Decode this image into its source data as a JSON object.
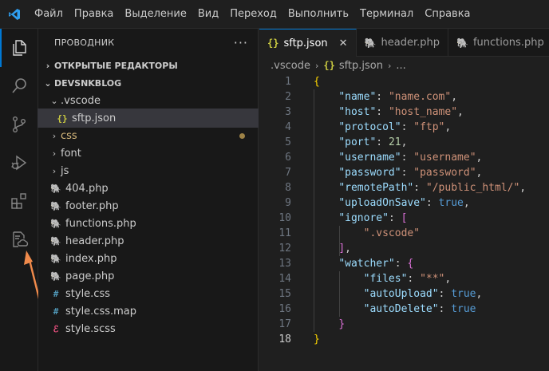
{
  "menu": [
    "Файл",
    "Правка",
    "Выделение",
    "Вид",
    "Переход",
    "Выполнить",
    "Терминал",
    "Справка"
  ],
  "sidebar": {
    "title": "ПРОВОДНИК",
    "more": "···",
    "open_editors": "ОТКРЫТЫЕ РЕДАКТОРЫ",
    "project": "DEVSNKBLOG",
    "tree": [
      {
        "label": ".vscode",
        "type": "folder-open"
      },
      {
        "label": "sftp.json",
        "type": "json"
      },
      {
        "label": "css",
        "type": "folder"
      },
      {
        "label": "font",
        "type": "folder"
      },
      {
        "label": "js",
        "type": "folder"
      },
      {
        "label": "404.php",
        "type": "php"
      },
      {
        "label": "footer.php",
        "type": "php"
      },
      {
        "label": "functions.php",
        "type": "php"
      },
      {
        "label": "header.php",
        "type": "php"
      },
      {
        "label": "index.php",
        "type": "php"
      },
      {
        "label": "page.php",
        "type": "php"
      },
      {
        "label": "style.css",
        "type": "css"
      },
      {
        "label": "style.css.map",
        "type": "css"
      },
      {
        "label": "style.scss",
        "type": "scss"
      }
    ]
  },
  "tabs": [
    {
      "label": "sftp.json",
      "active": true
    },
    {
      "label": "header.php",
      "active": false
    },
    {
      "label": "functions.php",
      "active": false
    }
  ],
  "breadcrumb": {
    "folder": ".vscode",
    "file": "sftp.json",
    "trail": "..."
  },
  "editor": {
    "line_numbers": [
      "1",
      "2",
      "3",
      "4",
      "5",
      "6",
      "7",
      "8",
      "9",
      "10",
      "11",
      "12",
      "13",
      "14",
      "15",
      "16",
      "17",
      "18"
    ],
    "current_line": "18",
    "k_name": "\"name\"",
    "v_name": "\"name.com\"",
    "k_host": "\"host\"",
    "v_host": "\"host_name\"",
    "k_protocol": "\"protocol\"",
    "v_protocol": "\"ftp\"",
    "k_port": "\"port\"",
    "v_port": "21",
    "k_username": "\"username\"",
    "v_username": "\"username\"",
    "k_password": "\"password\"",
    "v_password": "\"password\"",
    "k_remote": "\"remotePath\"",
    "v_remote": "\"/public_html/\"",
    "k_upload": "\"uploadOnSave\"",
    "v_upload": "true",
    "k_ignore": "\"ignore\"",
    "v_ignore": "\".vscode\"",
    "k_watcher": "\"watcher\"",
    "k_files": "\"files\"",
    "v_files": "\"**\"",
    "k_autoup": "\"autoUpload\"",
    "v_autoup": "true",
    "k_autodel": "\"autoDelete\"",
    "v_autodel": "true"
  },
  "colors": {
    "accent": "#0078d4",
    "annotation_arrow": "#f08a4b",
    "php_icon": "#a074c4",
    "json_icon": "#cbcb41",
    "css_icon": "#519aba",
    "scss_icon": "#f55385"
  }
}
